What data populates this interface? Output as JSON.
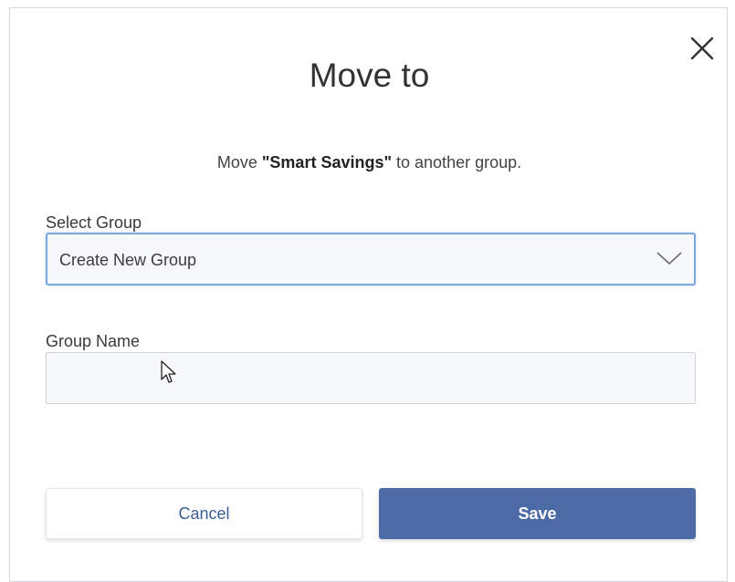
{
  "dialog": {
    "title": "Move to",
    "subtitle_prefix": "Move ",
    "subtitle_item": "\"Smart Savings\"",
    "subtitle_suffix": " to another group.",
    "close_icon": "close-icon"
  },
  "select_group": {
    "label": "Select Group",
    "selected_value": "Create New Group",
    "chevron_icon": "chevron-down-icon"
  },
  "group_name": {
    "label": "Group Name",
    "value": "",
    "placeholder": ""
  },
  "actions": {
    "cancel_label": "Cancel",
    "save_label": "Save"
  },
  "colors": {
    "accent": "#4b6aa6",
    "link": "#3b5e92",
    "focus_border": "#7aa7dd"
  }
}
